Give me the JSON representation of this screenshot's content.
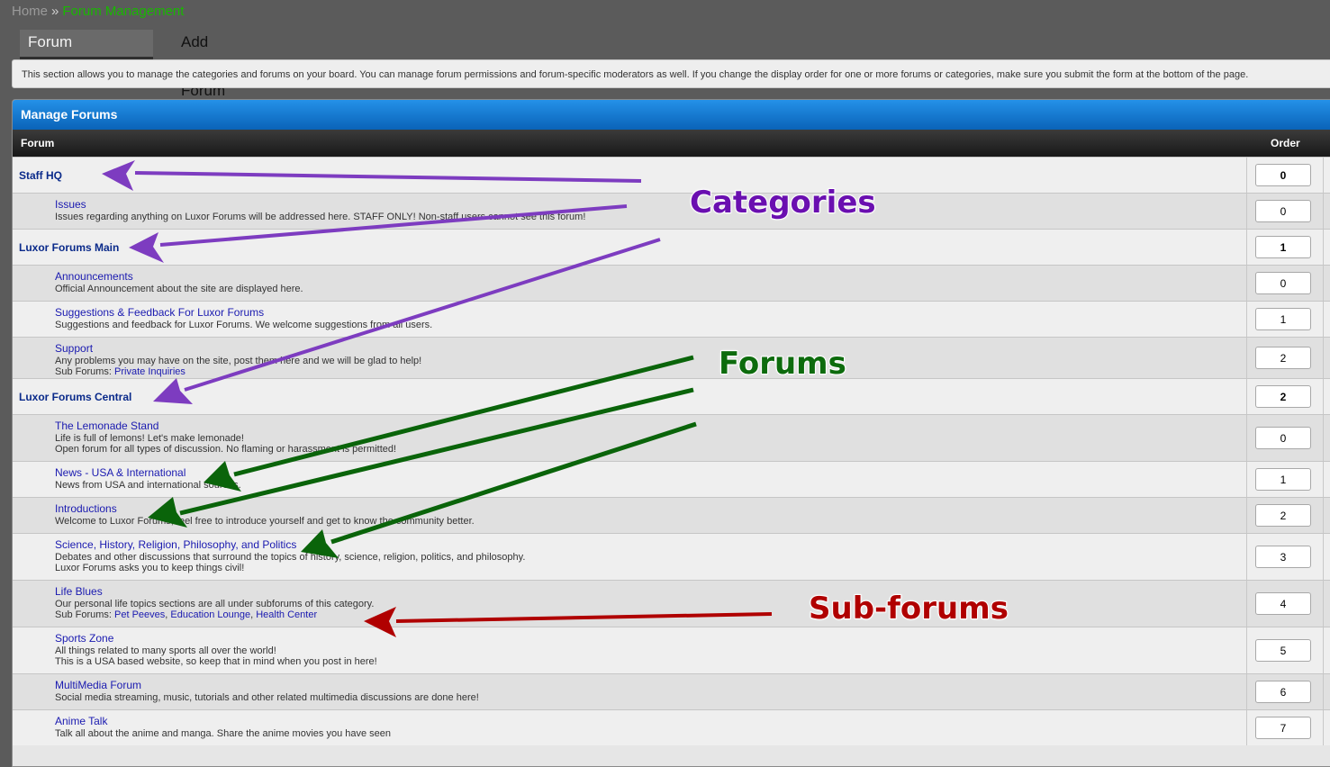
{
  "breadcrumb": {
    "home": "Home",
    "separator": "»",
    "current": "Forum Management"
  },
  "tabs": [
    {
      "label": "Forum Management"
    },
    {
      "label": "Add New Forum"
    }
  ],
  "description": "This section allows you to manage the categories and forums on your board. You can manage forum permissions and forum-specific moderators as well. If you change the display order for one or more forums or categories, make sure you submit the form at the bottom of the page.",
  "panel": {
    "title": "Manage Forums",
    "col_forum": "Forum",
    "col_order": "Order"
  },
  "rows": [
    {
      "type": "category",
      "name": "Staff HQ",
      "order": "0"
    },
    {
      "type": "forum",
      "name": "Issues",
      "desc": [
        "Issues regarding anything on Luxor Forums will be addressed here. STAFF ONLY! Non-staff users cannot see this forum!"
      ],
      "order": "0"
    },
    {
      "type": "category",
      "name": "Luxor Forums Main",
      "order": "1"
    },
    {
      "type": "forum",
      "name": "Announcements",
      "desc": [
        "Official Announcement about the site are displayed here."
      ],
      "order": "0"
    },
    {
      "type": "forum",
      "name": "Suggestions & Feedback For Luxor Forums",
      "desc": [
        "Suggestions and feedback for Luxor Forums. We welcome suggestions from all users."
      ],
      "order": "1"
    },
    {
      "type": "forum",
      "name": "Support",
      "desc": [
        "Any problems you may have on the site, post them here and we will be glad to help!"
      ],
      "sub_label": "Sub Forums:",
      "subforums": [
        "Private Inquiries"
      ],
      "order": "2"
    },
    {
      "type": "category",
      "name": "Luxor Forums Central",
      "order": "2"
    },
    {
      "type": "forum",
      "name": "The Lemonade Stand",
      "desc": [
        "Life is full of lemons! Let's make lemonade!",
        "Open forum for all types of discussion. No flaming or harassment is permitted!"
      ],
      "order": "0"
    },
    {
      "type": "forum",
      "name": "News - USA & International",
      "desc": [
        "News from USA and international sources."
      ],
      "order": "1"
    },
    {
      "type": "forum",
      "name": "Introductions",
      "desc": [
        "Welcome to Luxor Forums, feel free to introduce yourself and get to know the community better."
      ],
      "order": "2"
    },
    {
      "type": "forum",
      "name": "Science, History, Religion, Philosophy, and Politics",
      "desc": [
        "Debates and other discussions that surround the topics of history, science, religion, politics, and philosophy.",
        "Luxor Forums asks you to keep things civil!"
      ],
      "order": "3"
    },
    {
      "type": "forum",
      "name": "Life Blues",
      "desc": [
        "Our personal life topics sections are all under subforums of this category."
      ],
      "sub_label": "Sub Forums:",
      "subforums": [
        "Pet Peeves",
        "Education Lounge",
        "Health Center"
      ],
      "order": "4"
    },
    {
      "type": "forum",
      "name": "Sports Zone",
      "desc": [
        "All things related to many sports all over the world!",
        "This is a USA based website, so keep that in mind when you post in here!"
      ],
      "order": "5"
    },
    {
      "type": "forum",
      "name": "MultiMedia Forum",
      "desc": [
        "Social media streaming, music, tutorials and other related multimedia discussions are done here!"
      ],
      "order": "6"
    },
    {
      "type": "forum",
      "name": "Anime Talk",
      "desc": [
        "Talk all about the anime and manga. Share the anime movies you have seen"
      ],
      "order": "7"
    }
  ],
  "annotations": {
    "categories": {
      "label": "Categories",
      "color": "#6a0fb0",
      "arrow_color": "#7d3cc0"
    },
    "forums": {
      "label": "Forums",
      "color": "#0d6b0d",
      "arrow_color": "#0a640a"
    },
    "subforums": {
      "label": "Sub-forums",
      "color": "#b00000",
      "arrow_color": "#b00000"
    }
  }
}
